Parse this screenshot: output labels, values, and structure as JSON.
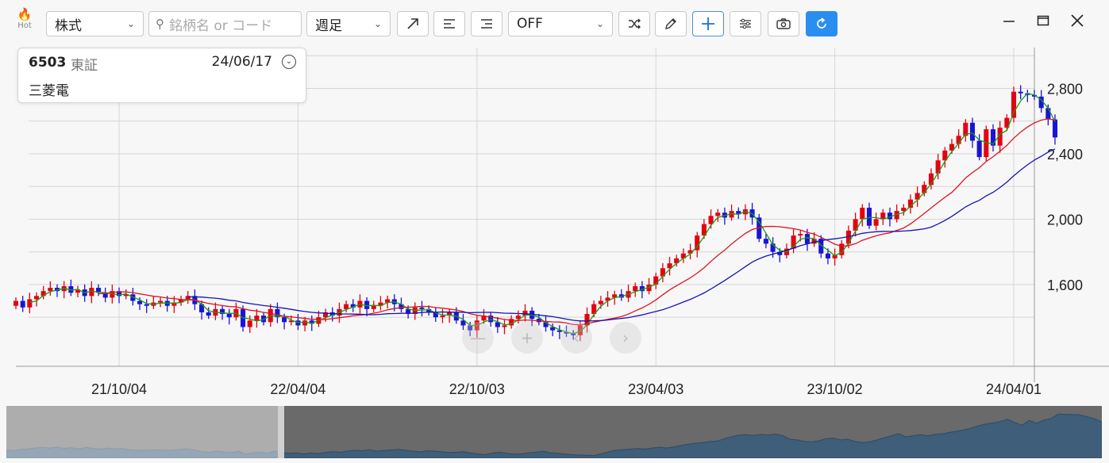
{
  "toolbar": {
    "hot_label": "Hot",
    "market_select": "株式",
    "search_placeholder": "銘柄名 or コード",
    "period_select": "週足",
    "indicator_select": "OFF",
    "buttons": [
      "trend-line",
      "align-left",
      "align-right",
      "shuffle",
      "pen",
      "crosshair",
      "settings",
      "camera",
      "refresh"
    ]
  },
  "info": {
    "code": "6503",
    "exchange": "東証",
    "date": "24/06/17",
    "name": "三菱電"
  },
  "colors": {
    "up": "#e60012",
    "down": "#1a14d6",
    "ma_short": "#13a013",
    "ma_mid": "#e0141e",
    "ma_long": "#1414b8",
    "accent": "#2a8ef0"
  },
  "chart_data": {
    "type": "candlestick",
    "x_tick_labels": [
      "21/10/04",
      "22/04/04",
      "22/10/03",
      "23/04/03",
      "23/10/02",
      "24/04/01"
    ],
    "y_tick_labels": [
      "1,600",
      "2,000",
      "2,400",
      "2,800"
    ],
    "y_ticks": [
      1600,
      2000,
      2400,
      2800
    ],
    "ylim": [
      1100,
      3050
    ],
    "x_range_weeks": [
      0,
      148
    ],
    "x_tick_weeks": [
      15,
      41,
      67,
      93,
      119,
      145
    ],
    "grid": true,
    "y_axis_position": "right",
    "close_series": [
      1500,
      1460,
      1510,
      1530,
      1560,
      1580,
      1560,
      1590,
      1550,
      1570,
      1530,
      1580,
      1550,
      1520,
      1560,
      1530,
      1540,
      1500,
      1480,
      1470,
      1490,
      1500,
      1470,
      1490,
      1510,
      1530,
      1480,
      1430,
      1410,
      1450,
      1420,
      1400,
      1450,
      1340,
      1380,
      1410,
      1370,
      1450,
      1400,
      1370,
      1380,
      1350,
      1380,
      1360,
      1400,
      1430,
      1410,
      1450,
      1480,
      1460,
      1500,
      1450,
      1470,
      1490,
      1510,
      1480,
      1450,
      1420,
      1460,
      1450,
      1430,
      1400,
      1410,
      1430,
      1380,
      1350,
      1320,
      1380,
      1410,
      1370,
      1340,
      1350,
      1390,
      1410,
      1440,
      1390,
      1370,
      1340,
      1320,
      1310,
      1300,
      1290,
      1350,
      1420,
      1480,
      1500,
      1520,
      1540,
      1520,
      1560,
      1590,
      1560,
      1600,
      1650,
      1700,
      1730,
      1760,
      1790,
      1810,
      1900,
      1970,
      2020,
      2040,
      2010,
      2050,
      2030,
      2060,
      2010,
      1880,
      1850,
      1800,
      1780,
      1820,
      1900,
      1910,
      1850,
      1880,
      1790,
      1760,
      1780,
      1850,
      1930,
      2000,
      2070,
      1960,
      2000,
      2040,
      2000,
      2050,
      2070,
      2120,
      2160,
      2210,
      2280,
      2360,
      2420,
      2460,
      2510,
      2590,
      2480,
      2380,
      2550,
      2450,
      2560,
      2620,
      2780,
      2770,
      2760,
      2750,
      2680,
      2610,
      2500
    ]
  }
}
